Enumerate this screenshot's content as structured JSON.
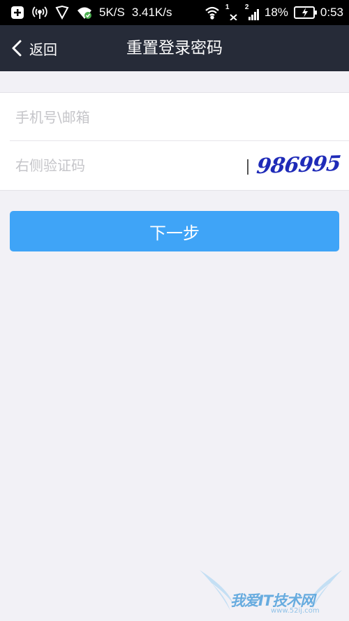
{
  "status_bar": {
    "speed_1": "5K/S",
    "speed_2": "3.41K/s",
    "sim1": "1",
    "sim2": "2",
    "battery": "18%",
    "time": "0:53"
  },
  "nav": {
    "back_label": "返回",
    "title": "重置登录密码"
  },
  "form": {
    "account_placeholder": "手机号\\邮箱",
    "captcha_placeholder": "右侧验证码",
    "captcha_code": "986995"
  },
  "next_button": "下一步",
  "watermark": {
    "text": "我爱IT技术网",
    "url": "www.52ij.com"
  },
  "colors": {
    "nav_bg": "#262b38",
    "button": "#3fa4f7",
    "page_bg": "#f2f1f6",
    "captcha_text": "#1f2bb8"
  }
}
